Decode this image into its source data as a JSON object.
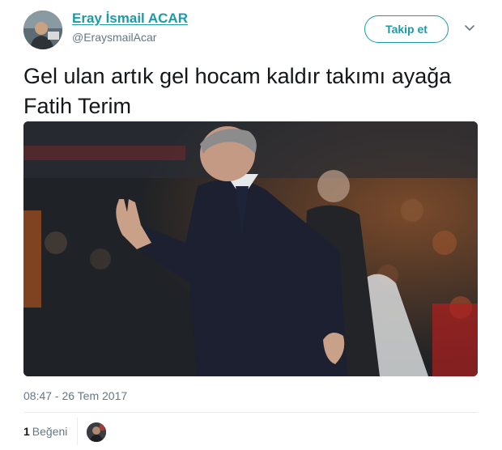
{
  "author": {
    "name": "Eray İsmail ACAR",
    "handle": "@EraysmailAcar"
  },
  "follow_button_label": "Takip et",
  "tweet": {
    "text": "Gel ulan artık gel hocam kaldır takımı ayağa Fatih Terim",
    "timestamp": "08:47 - 26 Tem 2017"
  },
  "engagement": {
    "like_count": "1",
    "like_label": "Beğeni"
  },
  "colors": {
    "accent": "#1b9aa8",
    "secondary_text": "#657786",
    "divider": "#e6ecf0"
  },
  "icons": {
    "more": "chevron-down-icon"
  }
}
